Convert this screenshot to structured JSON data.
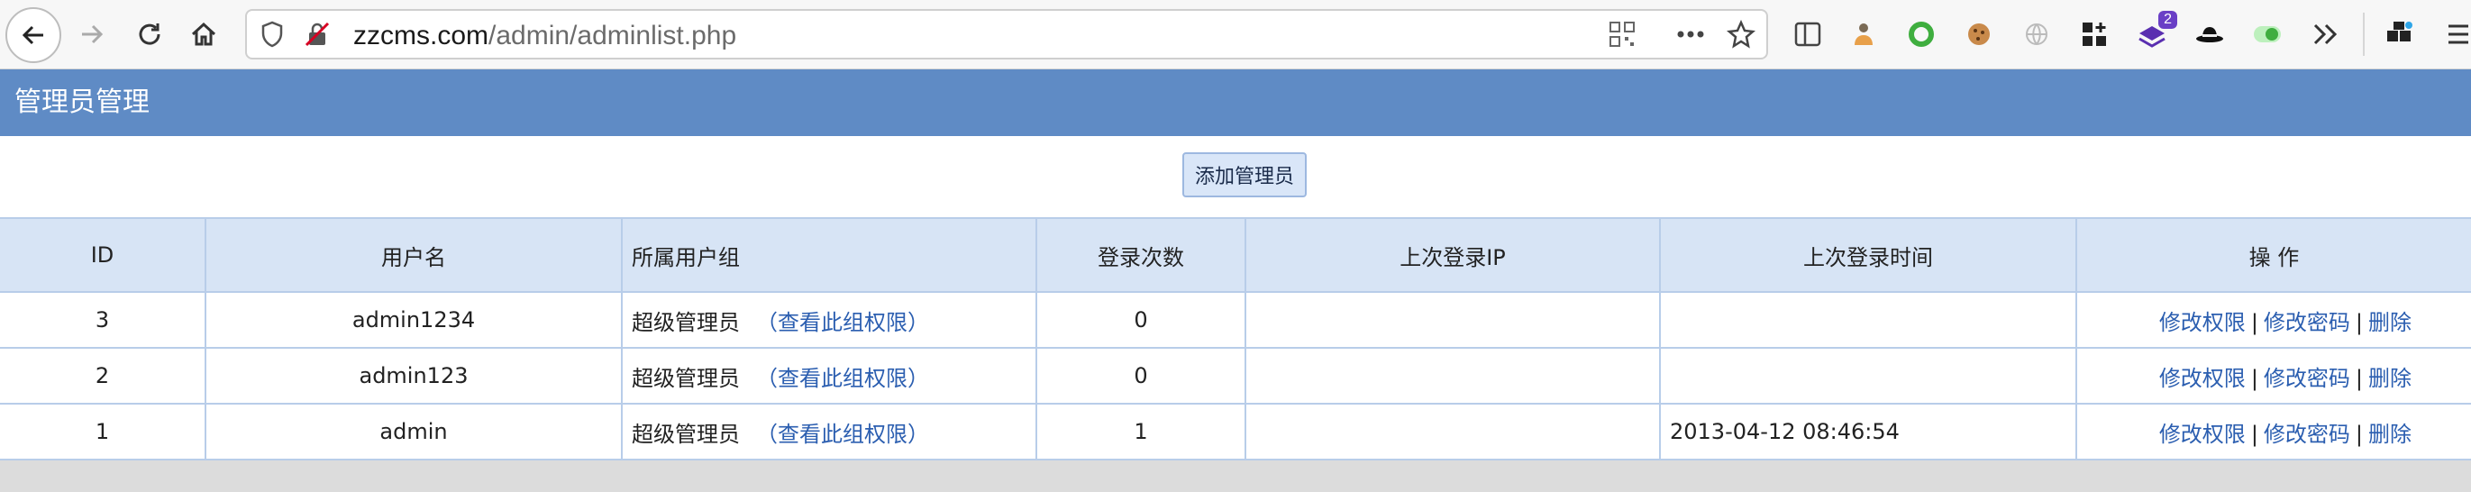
{
  "browser": {
    "url_host": "zzcms.com",
    "url_path": "/admin/adminlist.php",
    "ext_badge": "2"
  },
  "page": {
    "title": "管理员管理",
    "add_button": "添加管理员"
  },
  "table": {
    "headers": [
      "ID",
      "用户名",
      "所属用户组",
      "登录次数",
      "上次登录IP",
      "上次登录时间",
      "操 作"
    ],
    "rows": [
      {
        "id": "3",
        "username": "admin1234",
        "group": "超级管理员",
        "group_link": "（查看此组权限）",
        "logins": "0",
        "last_ip": "",
        "last_time": ""
      },
      {
        "id": "2",
        "username": "admin123",
        "group": "超级管理员",
        "group_link": "（查看此组权限）",
        "logins": "0",
        "last_ip": "",
        "last_time": ""
      },
      {
        "id": "1",
        "username": "admin",
        "group": "超级管理员",
        "group_link": "（查看此组权限）",
        "logins": "1",
        "last_ip": "",
        "last_time": "2013-04-12 08:46:54"
      }
    ],
    "actions": {
      "edit_perm": "修改权限",
      "edit_pwd": "修改密码",
      "delete": "删除",
      "separator": "|"
    }
  }
}
